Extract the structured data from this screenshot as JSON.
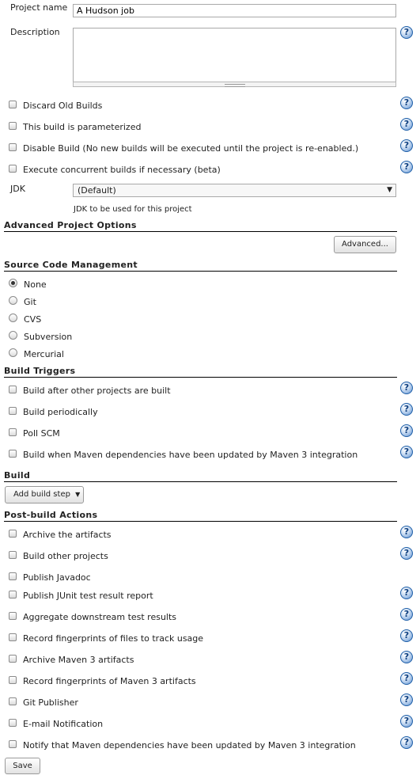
{
  "project": {
    "name_label": "Project name",
    "name_value": "A Hudson job",
    "description_label": "Description",
    "description_value": ""
  },
  "options": [
    {
      "label": "Discard Old Builds",
      "checked": false
    },
    {
      "label": "This build is parameterized",
      "checked": false
    },
    {
      "label": "Disable Build (No new builds will be executed until the project is re-enabled.)",
      "checked": false
    },
    {
      "label": "Execute concurrent builds if necessary (beta)",
      "checked": false
    }
  ],
  "jdk": {
    "label": "JDK",
    "selected": "(Default)",
    "hint": "JDK to be used for this project"
  },
  "advanced_project_options": {
    "title": "Advanced Project Options",
    "button": "Advanced..."
  },
  "scm": {
    "title": "Source Code Management",
    "selected": "None",
    "choices": [
      "None",
      "Git",
      "CVS",
      "Subversion",
      "Mercurial"
    ]
  },
  "build_triggers": {
    "title": "Build Triggers",
    "items": [
      "Build after other projects are built",
      "Build periodically",
      "Poll SCM",
      "Build when Maven dependencies have been updated by Maven 3 integration"
    ]
  },
  "build": {
    "title": "Build",
    "add_step_button": "Add build step"
  },
  "post_build": {
    "title": "Post-build Actions",
    "items": [
      "Archive the artifacts",
      "Build other projects",
      "Publish Javadoc",
      "Publish JUnit test result report",
      "Aggregate downstream test results",
      "Record fingerprints of files to track usage",
      "Archive Maven 3 artifacts",
      "Record fingerprints of Maven 3 artifacts",
      "Git Publisher",
      "E-mail Notification",
      "Notify that Maven dependencies have been updated by Maven 3 integration"
    ]
  },
  "save_button": "Save",
  "help_icon_glyph": "?",
  "colors": {
    "help_icon": "#1f5fa8",
    "section_rule": "#000000"
  }
}
